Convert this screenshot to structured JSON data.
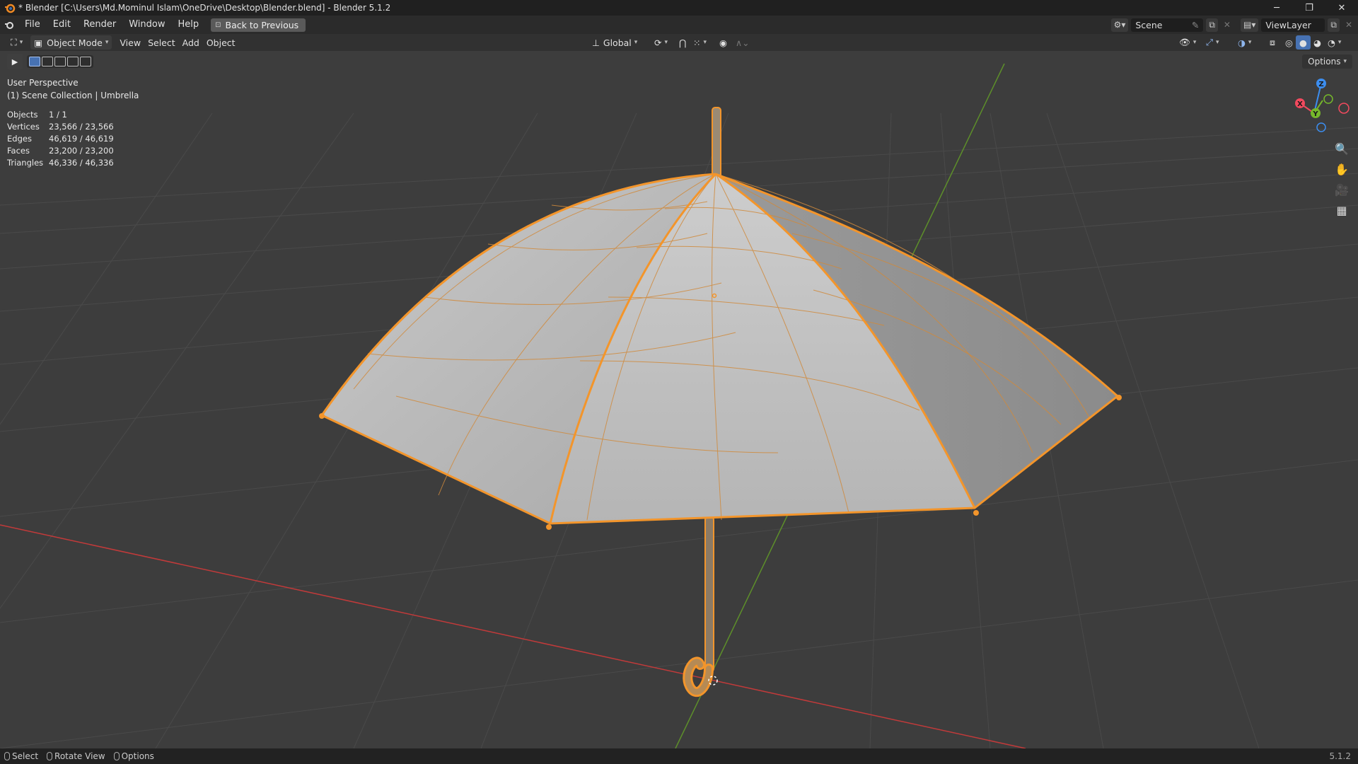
{
  "window": {
    "title": "* Blender [C:\\Users\\Md.Mominul Islam\\OneDrive\\Desktop\\Blender.blend] - Blender 5.1.2",
    "controls": [
      "─",
      "❐",
      "✕"
    ]
  },
  "menubar": {
    "items": [
      "File",
      "Edit",
      "Render",
      "Window",
      "Help"
    ],
    "back_button": "Back to Previous",
    "scene": "Scene",
    "view_layer": "ViewLayer"
  },
  "viewport_header": {
    "mode": "Object Mode",
    "menus": [
      "View",
      "Select",
      "Add",
      "Object"
    ],
    "orientation": "Global"
  },
  "toolbar": {
    "options_label": "Options"
  },
  "overlay": {
    "view_name": "User Perspective",
    "collection": "(1) Scene Collection | Umbrella"
  },
  "stats": [
    {
      "label": "Objects",
      "value": "1 / 1"
    },
    {
      "label": "Vertices",
      "value": "23,566 / 23,566"
    },
    {
      "label": "Edges",
      "value": "46,619 / 46,619"
    },
    {
      "label": "Faces",
      "value": "23,200 / 23,200"
    },
    {
      "label": "Triangles",
      "value": "46,336 / 46,336"
    }
  ],
  "gizmo": {
    "x_label": "X",
    "y_label": "Y",
    "z_label": "Z",
    "x_color": "#f24a5e",
    "y_color": "#76b82b",
    "z_color": "#3c8ef0"
  },
  "statusbar": {
    "items": [
      "Select",
      "Rotate View",
      "Options"
    ],
    "version": "5.1.2"
  },
  "colors": {
    "selection_orange": "#f3952b",
    "viewport_bg": "#3d3d3d"
  },
  "icons": {
    "blender_logo": "blender-logo-icon",
    "editor_type": "3d-viewport-icon",
    "zoom": "zoom-icon",
    "pan": "hand-icon",
    "camera": "camera-icon",
    "ortho": "grid-icon"
  }
}
